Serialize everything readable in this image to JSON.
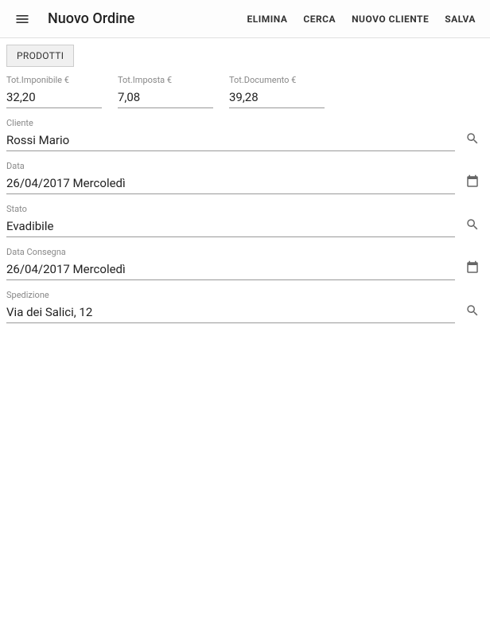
{
  "appBar": {
    "title": "Nuovo Ordine",
    "actions": {
      "elimina": "ELIMINA",
      "cerca": "CERCA",
      "nuovoCliente": "NUOVO CLIENTE",
      "salva": "SALVA"
    }
  },
  "prodottiButton": "PRODOTTI",
  "totals": {
    "imponibile": {
      "label": "Tot.Imponibile €",
      "value": "32,20"
    },
    "imposta": {
      "label": "Tot.Imposta €",
      "value": "7,08"
    },
    "documento": {
      "label": "Tot.Documento €",
      "value": "39,28"
    }
  },
  "fields": {
    "cliente": {
      "label": "Cliente",
      "value": "Rossi Mario"
    },
    "data": {
      "label": "Data",
      "value": "26/04/2017 Mercoledì"
    },
    "stato": {
      "label": "Stato",
      "value": "Evadibile"
    },
    "dataConsegna": {
      "label": "Data Consegna",
      "value": "26/04/2017 Mercoledì"
    },
    "spedizione": {
      "label": "Spedizione",
      "value": "Via dei Salici, 12"
    }
  }
}
